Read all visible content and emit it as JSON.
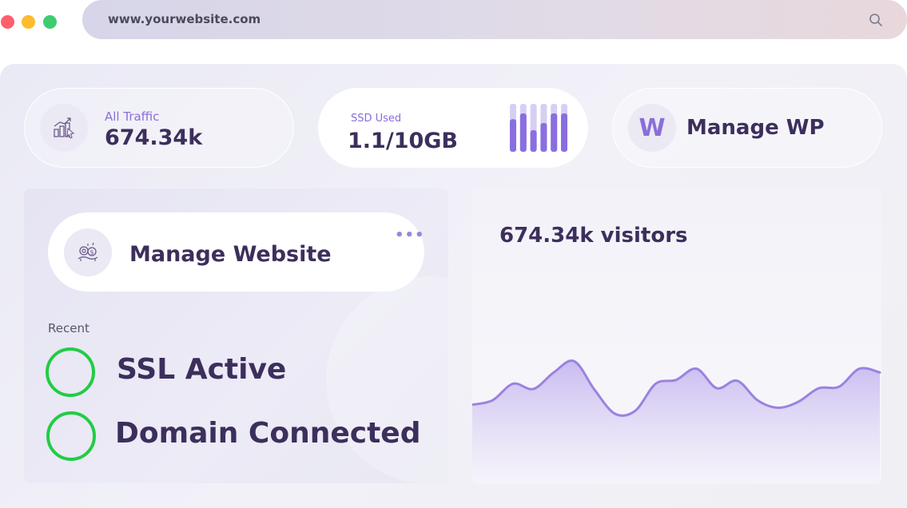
{
  "browser": {
    "url": "www.yourwebsite.com",
    "controls": [
      "close",
      "minimize",
      "maximize"
    ],
    "search_icon": "search-icon"
  },
  "stats": {
    "traffic": {
      "label": "All Traffic",
      "value": "674.34k",
      "icon": "traffic-chart-icon"
    },
    "ssd": {
      "label": "SSD Used",
      "value": "1.1/10GB",
      "bar_levels": [
        0.68,
        0.8,
        0.45,
        0.6,
        0.8,
        0.8
      ],
      "icon": "storage-bars-icon"
    },
    "wp": {
      "letter": "W",
      "label": "Manage WP"
    }
  },
  "manage_website": {
    "label": "Manage Website",
    "icon": "website-settings-icon",
    "menu_icon": "more-dots-icon"
  },
  "recent": {
    "label": "Recent",
    "items": [
      {
        "label": "SSL Active",
        "status_color": "#22cc44"
      },
      {
        "label": "Domain Connected",
        "status_color": "#22cc44"
      }
    ]
  },
  "visitors_chart": {
    "title": "674.34k visitors"
  },
  "chart_data": {
    "type": "area",
    "title": "674.34k visitors",
    "xlabel": "",
    "ylabel": "",
    "grid": false,
    "legend": "none",
    "x": [
      0,
      1,
      2,
      3,
      4,
      5,
      6,
      7,
      8,
      9,
      10,
      11,
      12,
      13,
      14,
      15,
      16,
      17,
      18,
      19,
      20
    ],
    "series": [
      {
        "values": [
          12,
          18,
          40,
          33,
          55,
          70,
          32,
          0,
          4,
          40,
          45,
          60,
          34,
          44,
          18,
          8,
          16,
          34,
          36,
          60,
          55
        ]
      }
    ],
    "ylim": [
      0,
      100
    ],
    "colors": {
      "line": "#9b82e0",
      "fill_top": "#c7b8f0",
      "fill_bottom": "#f4f2fa"
    }
  }
}
